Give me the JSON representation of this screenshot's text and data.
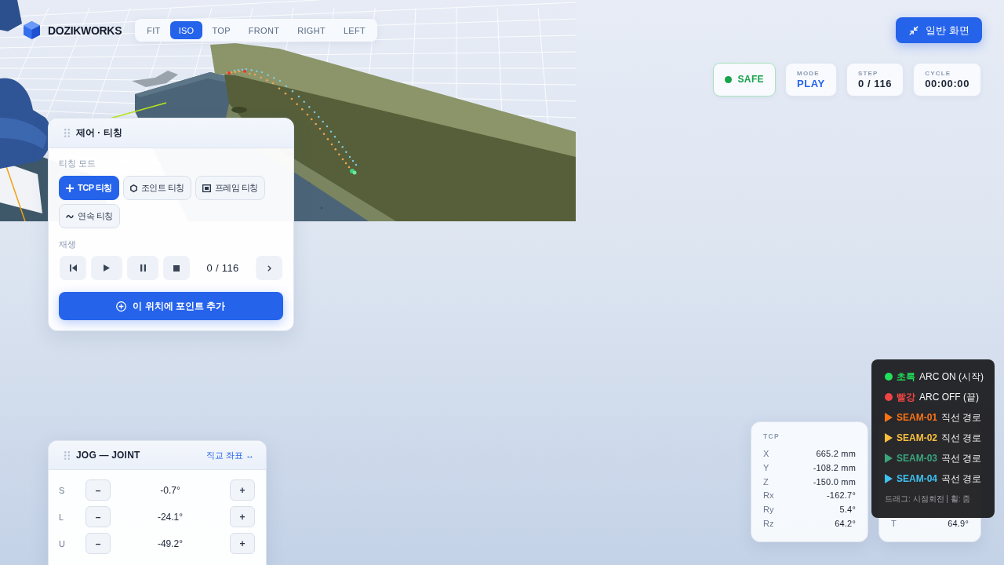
{
  "brand": {
    "name": "DOZIKWORKS"
  },
  "view_tabs": [
    {
      "label": "FIT",
      "selected": false
    },
    {
      "label": "ISO",
      "selected": true
    },
    {
      "label": "TOP",
      "selected": false
    },
    {
      "label": "FRONT",
      "selected": false
    },
    {
      "label": "RIGHT",
      "selected": false
    },
    {
      "label": "LEFT",
      "selected": false
    }
  ],
  "screen_button": {
    "label": "일반 화면"
  },
  "status": [
    {
      "kind": "indicator",
      "value": "SAFE"
    },
    {
      "kind": "mode",
      "label": "MODE",
      "value": "PLAY"
    },
    {
      "kind": "counter",
      "label": "STEP",
      "value": "0 / 116"
    },
    {
      "kind": "counter",
      "label": "CYCLE",
      "value": "00:00:00"
    }
  ],
  "control_panel": {
    "title": "제어 · 티칭",
    "mode_label": "티칭 모드",
    "modes": [
      {
        "kind": "tcp",
        "label": "TCP 티칭",
        "selected": true
      },
      {
        "kind": "joint",
        "label": "조인트 티칭",
        "selected": false
      },
      {
        "kind": "frame",
        "label": "프레임 티칭",
        "selected": false
      },
      {
        "kind": "continuous",
        "label": "연속 티칭",
        "selected": false
      }
    ],
    "playback_label": "재생",
    "step": "0 / 116",
    "add_point_button": "이 위치에 포인트 추가"
  },
  "jog_panel": {
    "title": "JOG — JOINT",
    "frame_link": "직교 좌표 ↔",
    "joints": [
      {
        "axis": "S",
        "decrease": "–",
        "value": "-0.7°",
        "increase": "+"
      },
      {
        "axis": "L",
        "decrease": "–",
        "value": "-24.1°",
        "increase": "+"
      },
      {
        "axis": "U",
        "decrease": "–",
        "value": "-49.2°",
        "increase": "+"
      }
    ]
  },
  "tcp_readout": {
    "title": "TCP",
    "rows": [
      {
        "axis": "X",
        "value": "665.2 mm"
      },
      {
        "axis": "Y",
        "value": "-108.2 mm"
      },
      {
        "axis": "Z",
        "value": "-150.0 mm"
      },
      {
        "axis": "Rx",
        "value": "-162.7°"
      },
      {
        "axis": "Ry",
        "value": "5.4°"
      },
      {
        "axis": "Rz",
        "value": "64.2°"
      }
    ]
  },
  "joint_readout": {
    "rows": [
      {
        "axis": "T",
        "value": "64.9°"
      }
    ]
  },
  "legend": {
    "items": [
      {
        "kind": "dot",
        "color": "#22e05a",
        "key": "초록",
        "text": "ARC ON (시작)"
      },
      {
        "kind": "dot",
        "color": "#f04444",
        "key": "빨강",
        "text": "ARC OFF (끝)"
      },
      {
        "kind": "arrow",
        "color": "#f97316",
        "key": "SEAM-01",
        "text": "직선 경로"
      },
      {
        "kind": "arrow",
        "color": "#fbbf3c",
        "key": "SEAM-02",
        "text": "직선 경로"
      },
      {
        "kind": "arrow",
        "color": "#3aa57c",
        "key": "SEAM-03",
        "text": "곡선 경로"
      },
      {
        "kind": "arrow",
        "color": "#3ec1f0",
        "key": "SEAM-04",
        "text": "곡선 경로"
      }
    ],
    "hint": "드래그: 시점회전 | 휠: 줌"
  }
}
